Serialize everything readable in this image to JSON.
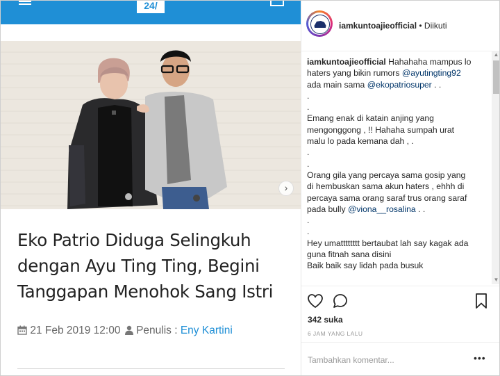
{
  "site": {
    "logo_text": "24/"
  },
  "article": {
    "headline": "Eko Patrio Diduga Selingkuh dengan Ayu Ting Ting, Begini Tanggapan Menohok Sang Istri",
    "date": "21 Feb 2019 12:00",
    "author_label": "Penulis :",
    "author_name": "Eny Kartini",
    "next_arrow": "›"
  },
  "instagram": {
    "username": "iamkuntoajieofficial",
    "follow_status": "• Diikuti",
    "caption_lines": [
      [
        {
          "t": "iamkuntoajieofficial",
          "k": "user"
        },
        {
          "t": " Hahahaha mampus lo",
          "k": "text"
        }
      ],
      [
        {
          "t": "haters yang bikin rumors ",
          "k": "text"
        },
        {
          "t": "@ayutingting92",
          "k": "mention"
        }
      ],
      [
        {
          "t": "ada main sama ",
          "k": "text"
        },
        {
          "t": "@ekopatriosuper",
          "k": "mention"
        },
        {
          "t": " . .",
          "k": "text"
        }
      ],
      [
        {
          "t": ".",
          "k": "text"
        }
      ],
      [
        {
          "t": ".",
          "k": "text"
        }
      ],
      [
        {
          "t": "Emang enak di katain anjing yang",
          "k": "text"
        }
      ],
      [
        {
          "t": "mengonggong , !! Hahaha sumpah urat",
          "k": "text"
        }
      ],
      [
        {
          "t": "malu lo pada kemana dah , .",
          "k": "text"
        }
      ],
      [
        {
          "t": ".",
          "k": "text"
        }
      ],
      [
        {
          "t": ".",
          "k": "text"
        }
      ],
      [
        {
          "t": "Orang gila yang percaya sama gosip yang",
          "k": "text"
        }
      ],
      [
        {
          "t": "di hembuskan sama akun haters , ehhh di",
          "k": "text"
        }
      ],
      [
        {
          "t": "percaya sama orang saraf trus orang saraf",
          "k": "text"
        }
      ],
      [
        {
          "t": "pada bully ",
          "k": "text"
        },
        {
          "t": "@viona__rosalina",
          "k": "mention"
        },
        {
          "t": " . .",
          "k": "text"
        }
      ],
      [
        {
          "t": ".",
          "k": "text"
        }
      ],
      [
        {
          "t": ".",
          "k": "text"
        }
      ],
      [
        {
          "t": "Hey umatttttttt bertaubat lah say kagak ada",
          "k": "text"
        }
      ],
      [
        {
          "t": "guna fitnah sana disini",
          "k": "text"
        }
      ],
      [
        {
          "t": "Baik baik say lidah pada busuk",
          "k": "text"
        }
      ]
    ],
    "likes": "342 suka",
    "time_ago": "6 JAM YANG LALU",
    "comment_placeholder": "Tambahkan komentar...",
    "more_label": "•••",
    "icons": [
      "heart-icon",
      "comment-icon",
      "bookmark-icon"
    ]
  },
  "colors": {
    "site_blue": "#1f8fd6",
    "ig_text": "#262626",
    "mention": "#003569"
  }
}
